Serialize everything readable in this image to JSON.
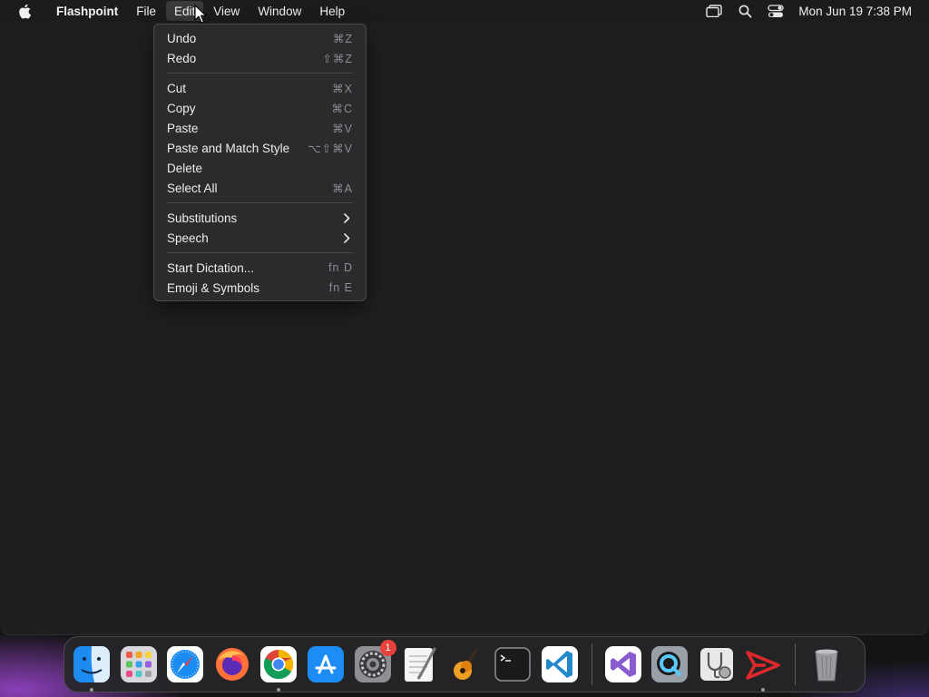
{
  "menubar": {
    "app_name": "Flashpoint",
    "menus": [
      "File",
      "Edit",
      "View",
      "Window",
      "Help"
    ],
    "clock": "Mon Jun 19  7:38 PM"
  },
  "edit_menu": {
    "items": [
      {
        "label": "Undo",
        "shortcut": "⌘Z"
      },
      {
        "label": "Redo",
        "shortcut": "⇧⌘Z"
      },
      {
        "label": "Cut",
        "shortcut": "⌘X"
      },
      {
        "label": "Copy",
        "shortcut": "⌘C"
      },
      {
        "label": "Paste",
        "shortcut": "⌘V"
      },
      {
        "label": "Paste and Match Style",
        "shortcut": "⌥⇧⌘V"
      },
      {
        "label": "Delete",
        "shortcut": ""
      },
      {
        "label": "Select All",
        "shortcut": "⌘A"
      },
      {
        "label": "Substitutions",
        "shortcut": ""
      },
      {
        "label": "Speech",
        "shortcut": ""
      },
      {
        "label": "Start Dictation...",
        "shortcut": "fn D"
      },
      {
        "label": "Emoji & Symbols",
        "shortcut": "fn E"
      }
    ]
  },
  "dock": {
    "apps": [
      {
        "icon": "finder-icon",
        "running": true
      },
      {
        "icon": "launchpad-icon",
        "running": false
      },
      {
        "icon": "safari-icon",
        "running": false
      },
      {
        "icon": "firefox-icon",
        "running": false
      },
      {
        "icon": "chrome-icon",
        "running": true
      },
      {
        "icon": "app-store-icon",
        "running": false
      },
      {
        "icon": "system-settings-icon",
        "running": false,
        "badge": "1"
      },
      {
        "icon": "textedit-icon",
        "running": false
      },
      {
        "icon": "garageband-icon",
        "running": false
      },
      {
        "icon": "terminal-icon",
        "running": false
      },
      {
        "icon": "vscode-icon",
        "running": false
      },
      {
        "icon": "visual-studio-icon",
        "running": false
      },
      {
        "icon": "quicktime-icon",
        "running": false
      },
      {
        "icon": "disk-utility-icon",
        "running": false
      },
      {
        "icon": "flashpoint-icon",
        "running": true
      },
      {
        "icon": "trash-icon",
        "running": false
      }
    ]
  },
  "colors": {
    "menubar_bg": "#1c1c1e",
    "menu_bg": "#2c2c2e",
    "badge": "#e8403a",
    "wallpaper_accent": "#8a3fb8"
  }
}
